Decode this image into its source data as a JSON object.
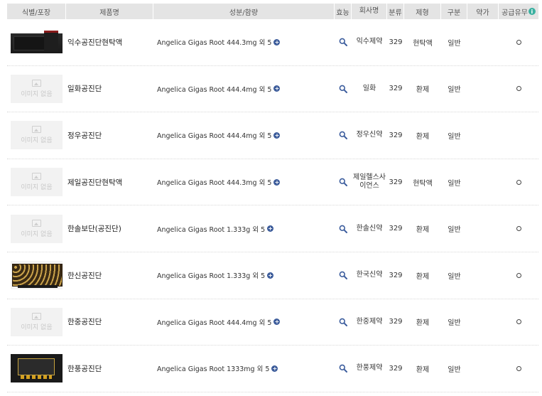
{
  "header": {
    "col1": "식별/포장",
    "col2": "제품명",
    "col3": "성분/함량",
    "col4": "효능",
    "col5": "회사명",
    "col6": "분류",
    "col7": "제형",
    "col8": "구분",
    "col9": "약가",
    "col10": "공급유무"
  },
  "no_image_label": "이미지 없음",
  "rows": [
    {
      "image": "photo",
      "name": "익수공진단현탁액",
      "ingredient": "Angelica Gigas Root 444.3mg 외 5",
      "company": "익수제약",
      "category": "329",
      "form": "현탁액",
      "type": "일반",
      "price": "",
      "supply": "O"
    },
    {
      "image": "none",
      "name": "일화공진단",
      "ingredient": "Angelica Gigas Root 444.4mg 외 5",
      "company": "일화",
      "category": "329",
      "form": "환제",
      "type": "일반",
      "price": "",
      "supply": "O"
    },
    {
      "image": "none",
      "name": "정우공진단",
      "ingredient": "Angelica Gigas Root 444.4mg 외 5",
      "company": "정우신약",
      "category": "329",
      "form": "환제",
      "type": "일반",
      "price": "",
      "supply": ""
    },
    {
      "image": "none",
      "name": "제일공진단현탁액",
      "ingredient": "Angelica Gigas Root 444.3mg 외 5",
      "company": "제일헬스사이언스",
      "category": "329",
      "form": "현탁액",
      "type": "일반",
      "price": "",
      "supply": "O"
    },
    {
      "image": "none",
      "name": "한솔보단(공진단)",
      "ingredient": "Angelica Gigas Root 1.333g 외 5",
      "company": "한솔신약",
      "category": "329",
      "form": "환제",
      "type": "일반",
      "price": "",
      "supply": "O"
    },
    {
      "image": "photo",
      "name": "한신공진단",
      "ingredient": "Angelica Gigas Root 1.333g 외 5",
      "company": "한국신약",
      "category": "329",
      "form": "환제",
      "type": "일반",
      "price": "",
      "supply": "O"
    },
    {
      "image": "none",
      "name": "한중공진단",
      "ingredient": "Angelica Gigas Root 444.4mg 외 5",
      "company": "한중제약",
      "category": "329",
      "form": "환제",
      "type": "일반",
      "price": "",
      "supply": "O"
    },
    {
      "image": "photo",
      "name": "한풍공진단",
      "ingredient": "Angelica Gigas Root 1333mg 외 5",
      "company": "한풍제약",
      "category": "329",
      "form": "환제",
      "type": "일반",
      "price": "",
      "supply": "O"
    }
  ]
}
